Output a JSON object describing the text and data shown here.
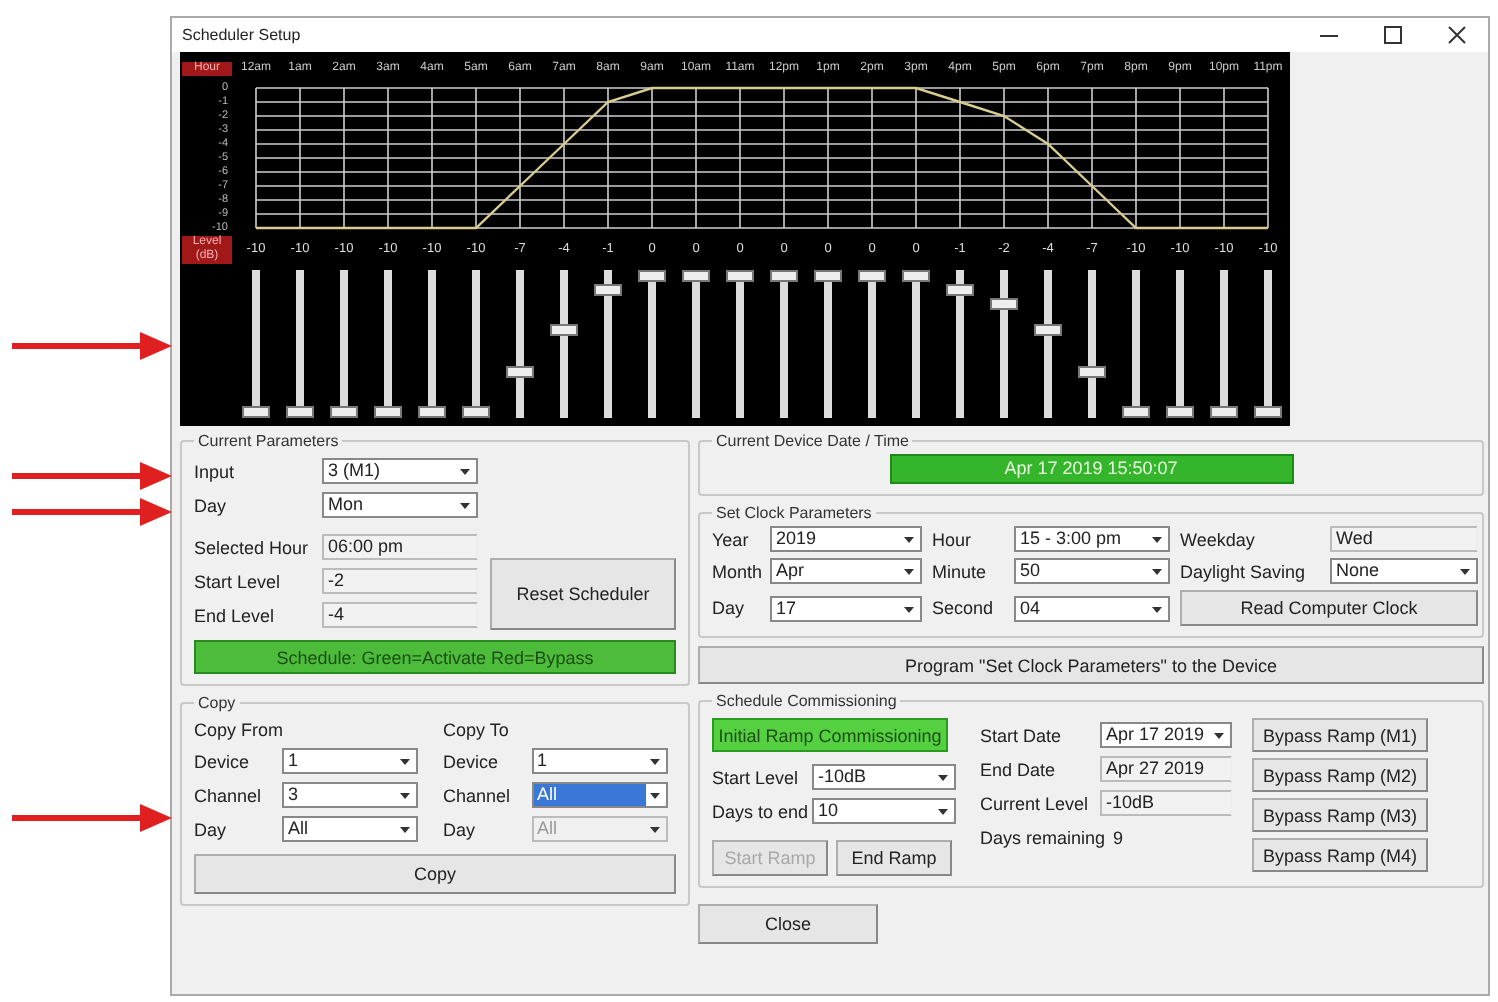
{
  "window": {
    "title": "Scheduler Setup"
  },
  "scheduler_chart": {
    "hour_label": "Hour",
    "level_label": [
      "Level",
      "(dB)"
    ],
    "chart_data": {
      "type": "line",
      "categories": [
        "12am",
        "1am",
        "2am",
        "3am",
        "4am",
        "5am",
        "6am",
        "7am",
        "8am",
        "9am",
        "10am",
        "11am",
        "12pm",
        "1pm",
        "2pm",
        "3pm",
        "4pm",
        "5pm",
        "6pm",
        "7pm",
        "8pm",
        "9pm",
        "10pm",
        "11pm"
      ],
      "grid": true,
      "series": [
        {
          "color": "#d8cc90",
          "values": [
            -10,
            -10,
            -10,
            -10,
            -10,
            -10,
            -7,
            -4,
            -1,
            0,
            0,
            0,
            0,
            0,
            0,
            0,
            -1,
            -2,
            -4,
            -7,
            -10,
            -10,
            -10,
            -10
          ]
        }
      ],
      "ylim": [
        -10,
        0
      ],
      "yticks": [
        0,
        -1,
        -2,
        -3,
        -4,
        -5,
        -6,
        -7,
        -8,
        -9,
        -10
      ]
    }
  },
  "sliders": [
    {
      "reading": "-10",
      "level": 0
    },
    {
      "reading": "-10",
      "level": 0
    },
    {
      "reading": "-10",
      "level": 0
    },
    {
      "reading": "-10",
      "level": 0
    },
    {
      "reading": "-10",
      "level": 0
    },
    {
      "reading": "-10",
      "level": 0
    },
    {
      "reading": "-7",
      "level": 0.3
    },
    {
      "reading": "-4",
      "level": 0.6
    },
    {
      "reading": "-1",
      "level": 0.9
    },
    {
      "reading": "0",
      "level": 1
    },
    {
      "reading": "0",
      "level": 1
    },
    {
      "reading": "0",
      "level": 1
    },
    {
      "reading": "0",
      "level": 1
    },
    {
      "reading": "0",
      "level": 1
    },
    {
      "reading": "0",
      "level": 1
    },
    {
      "reading": "0",
      "level": 1
    },
    {
      "reading": "-1",
      "level": 0.9
    },
    {
      "reading": "-2",
      "level": 0.8
    },
    {
      "reading": "-4",
      "level": 0.6
    },
    {
      "reading": "-7",
      "level": 0.3
    },
    {
      "reading": "-10",
      "level": 0
    },
    {
      "reading": "-10",
      "level": 0
    },
    {
      "reading": "-10",
      "level": 0
    },
    {
      "reading": "-10",
      "level": 0
    }
  ],
  "current_parameters": {
    "title": "Current Parameters",
    "selectors": [
      {
        "label": "Input",
        "value": "3 (M1)",
        "kind": "dropdown"
      },
      {
        "label": "Day",
        "value": "Mon",
        "kind": "dropdown"
      }
    ],
    "readouts": [
      {
        "label": "Selected Hour",
        "value": "06:00 pm",
        "kind": "text"
      },
      {
        "label": "Start Level",
        "value": "-2",
        "kind": "text"
      },
      {
        "label": "End Level",
        "value": "-4",
        "kind": "text"
      }
    ],
    "reset_button": "Reset Scheduler",
    "schedule_button": "Schedule: Green=Activate Red=Bypass"
  },
  "copy": {
    "title": "Copy",
    "from_title": "Copy From",
    "to_title": "Copy To",
    "from_fields": [
      {
        "label": "Device",
        "value": "1",
        "kind": "dropdown"
      },
      {
        "label": "Channel",
        "value": "3",
        "kind": "dropdown"
      },
      {
        "label": "Day",
        "value": "All",
        "kind": "dropdown"
      }
    ],
    "to_fields": [
      {
        "label": "Device",
        "value": "1",
        "kind": "dropdown",
        "selected": false,
        "disabled": false
      },
      {
        "label": "Channel",
        "value": "All",
        "kind": "dropdown",
        "selected": true,
        "disabled": false
      },
      {
        "label": "Day",
        "value": "All",
        "kind": "dropdown",
        "selected": false,
        "disabled": true
      }
    ],
    "copy_button": "Copy"
  },
  "device_time": {
    "title": "Current Device Date / Time",
    "value": "Apr 17 2019 15:50:07"
  },
  "set_clock": {
    "title": "Set Clock Parameters",
    "fields": [
      {
        "label": "Year",
        "value": "2019",
        "kind": "dropdown"
      },
      {
        "label": "Hour",
        "value": "15 - 3:00 pm",
        "kind": "dropdown"
      },
      {
        "label": "Weekday",
        "value": "Wed",
        "kind": "text"
      },
      {
        "label": "Month",
        "value": "Apr",
        "kind": "dropdown"
      },
      {
        "label": "Minute",
        "value": "50",
        "kind": "dropdown"
      },
      {
        "label": "Daylight Saving",
        "value": "None",
        "kind": "dropdown"
      },
      {
        "label": "Day",
        "value": "17",
        "kind": "dropdown"
      },
      {
        "label": "Second",
        "value": "04",
        "kind": "dropdown"
      }
    ],
    "read_clock_button": "Read Computer Clock"
  },
  "program_button": "Program \"Set Clock Parameters\" to the Device",
  "commissioning": {
    "title": "Schedule Commissioning",
    "initial_button": "Initial Ramp Commissioning",
    "settings": [
      {
        "label": "Start Level",
        "value": "-10dB",
        "kind": "dropdown"
      },
      {
        "label": "Days to end",
        "value": "10",
        "kind": "dropdown"
      }
    ],
    "ramp_buttons": [
      {
        "label": "Start Ramp",
        "disabled": true
      },
      {
        "label": "End Ramp",
        "disabled": false
      }
    ],
    "info": [
      {
        "label": "Start Date",
        "value": "Apr 17 2019",
        "kind": "dropdown"
      },
      {
        "label": "End Date",
        "value": "Apr 27 2019",
        "kind": "text"
      },
      {
        "label": "Current Level",
        "value": "-10dB",
        "kind": "text"
      },
      {
        "label": "Days remaining",
        "value": "9",
        "kind": "plain"
      }
    ],
    "bypass_buttons": [
      "Bypass Ramp (M1)",
      "Bypass Ramp (M2)",
      "Bypass Ramp (M3)",
      "Bypass Ramp (M4)"
    ]
  },
  "close_button": "Close"
}
